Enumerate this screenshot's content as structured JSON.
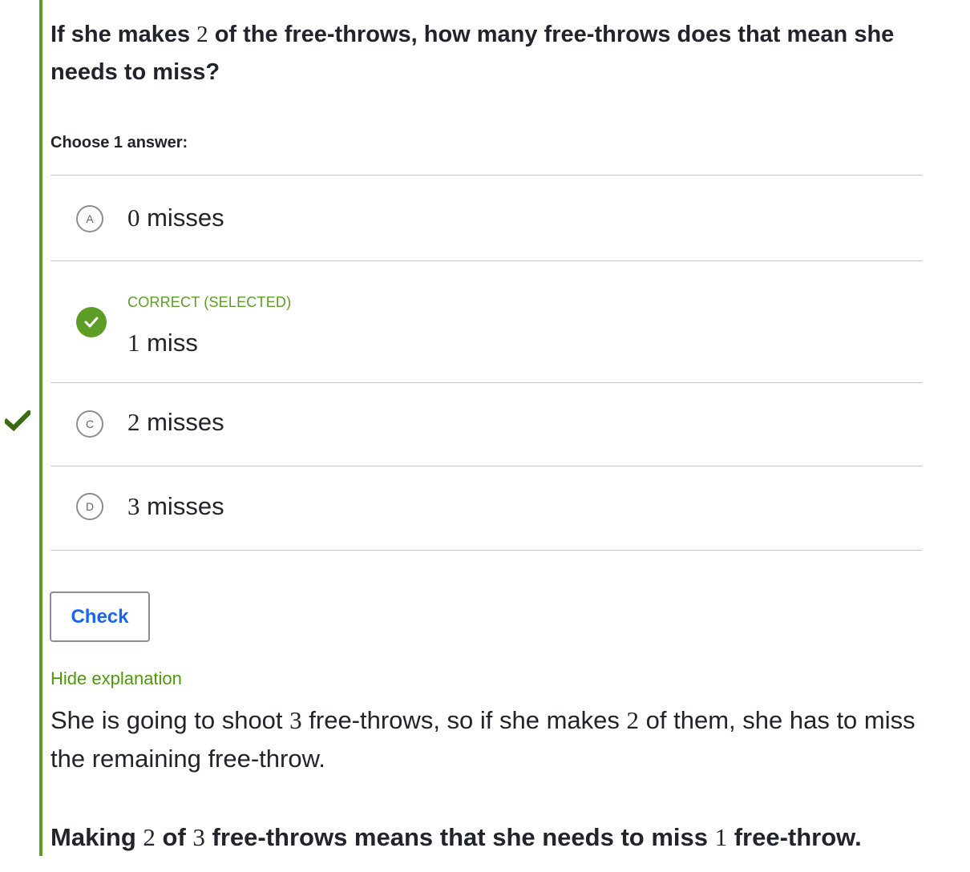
{
  "question": {
    "part1": "If she makes ",
    "num": "2",
    "part2": " of the free-throws, how many free-throws does that mean she needs to miss?"
  },
  "prompt": "Choose 1 answer:",
  "choices": [
    {
      "letter": "A",
      "num": "0",
      "text": " misses"
    },
    {
      "letter": "B",
      "num": "1",
      "text": " miss",
      "status": "CORRECT (SELECTED)"
    },
    {
      "letter": "C",
      "num": "2",
      "text": " misses"
    },
    {
      "letter": "D",
      "num": "3",
      "text": " misses"
    }
  ],
  "check_label": "Check",
  "hide_explanation_label": "Hide explanation",
  "explanation": {
    "p1": "She is going to shoot ",
    "n1": "3",
    "p2": " free-throws, so if she makes ",
    "n2": "2",
    "p3": " of them, she has to miss the remaining free-throw."
  },
  "conclusion": {
    "p1": "Making ",
    "n1": "2",
    "p2": " of ",
    "n2": "3",
    "p3": " free-throws means that she needs to miss ",
    "n3": "1",
    "p4": " free-throw."
  },
  "colors": {
    "accent_green": "#5c9e25",
    "link_blue": "#1865f2",
    "text": "#21242c",
    "side_check": "#3a6b10"
  },
  "icons": {
    "side": "checkmark-icon",
    "correct": "check-circle-icon"
  }
}
